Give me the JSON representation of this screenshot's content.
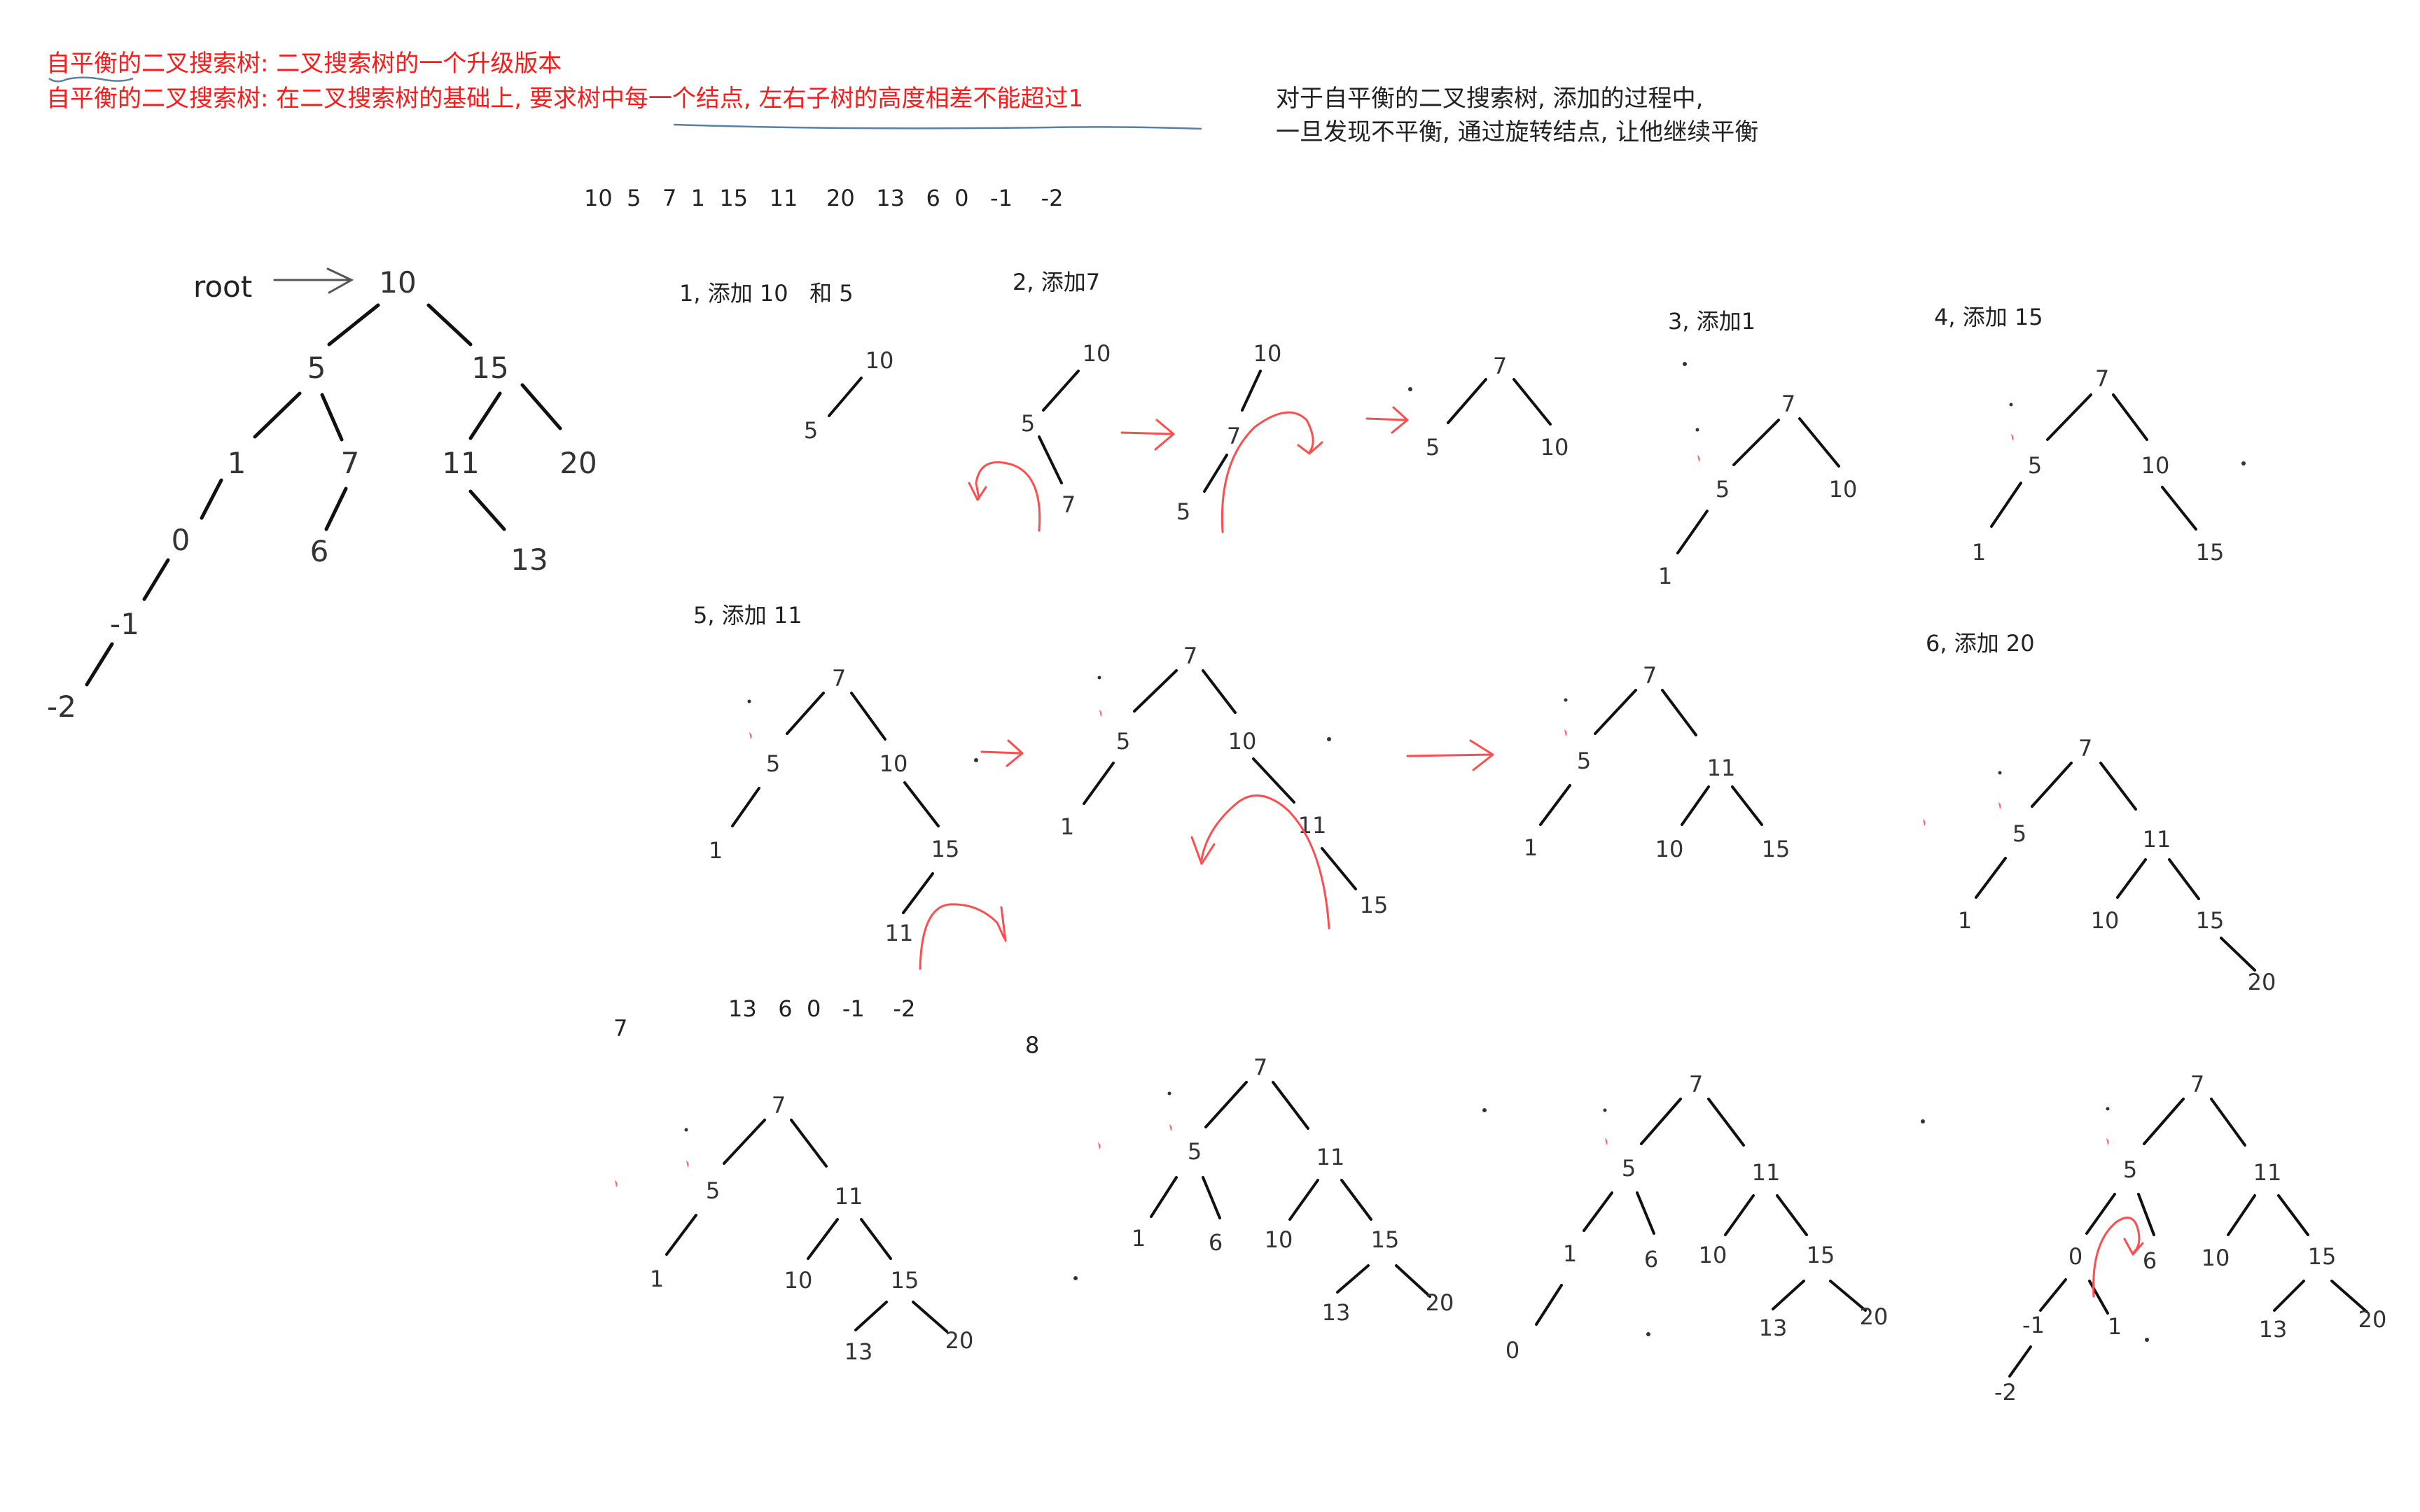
{
  "heading": {
    "line1": "自平衡的二叉搜索树:  二叉搜索树的一个升级版本",
    "line2": "自平衡的二叉搜索树: 在二叉搜索树的基础上,  要求树中每一个结点, 左右子树的高度相差不能超过1"
  },
  "note": {
    "line1": "对于自平衡的二叉搜索树, 添加的过程中,",
    "line2": "一旦发现不平衡,  通过旋转结点, 让他继续平衡"
  },
  "sequence": "10  5   7  1  15   11    20   13   6  0   -1    -2",
  "root_label": "root",
  "steps": {
    "s1": "1, 添加 10   和 5",
    "s2": "2, 添加7",
    "s3": "3, 添加1",
    "s4": "4, 添加 15",
    "s5": "5, 添加 11",
    "s6": "6, 添加 20",
    "s7": "7",
    "s7_remaining": "13   6  0   -1    -2",
    "s8": "8"
  },
  "trees": {
    "main": [
      "10",
      "5",
      "15",
      "1",
      "7",
      "11",
      "20",
      "0",
      "6",
      "13",
      "-1",
      "-2"
    ],
    "s1": [
      "10",
      "5"
    ],
    "s2a": [
      "10",
      "5",
      "7"
    ],
    "s2b": [
      "10",
      "7",
      "5"
    ],
    "s2c": [
      "7",
      "5",
      "10"
    ],
    "s3": [
      "7",
      "5",
      "10",
      "1"
    ],
    "s4": [
      "7",
      "5",
      "10",
      "1",
      "15"
    ],
    "s5a": [
      "7",
      "5",
      "10",
      "1",
      "15",
      "11"
    ],
    "s5b": [
      "7",
      "5",
      "10",
      "1",
      "11",
      "15"
    ],
    "s5c": [
      "7",
      "5",
      "11",
      "1",
      "10",
      "15"
    ],
    "s6": [
      "7",
      "5",
      "11",
      "1",
      "10",
      "15",
      "20"
    ],
    "s7": [
      "7",
      "5",
      "11",
      "1",
      "10",
      "15",
      "13",
      "20"
    ],
    "s8a": [
      "7",
      "5",
      "11",
      "1",
      "6",
      "10",
      "15",
      "13",
      "20"
    ],
    "s8b": [
      "7",
      "5",
      "11",
      "1",
      "6",
      "10",
      "15",
      "0",
      "13",
      "20"
    ],
    "s8c": [
      "7",
      "5",
      "11",
      "0",
      "6",
      "10",
      "15",
      "-1",
      "1",
      "13",
      "20",
      "-2"
    ]
  }
}
